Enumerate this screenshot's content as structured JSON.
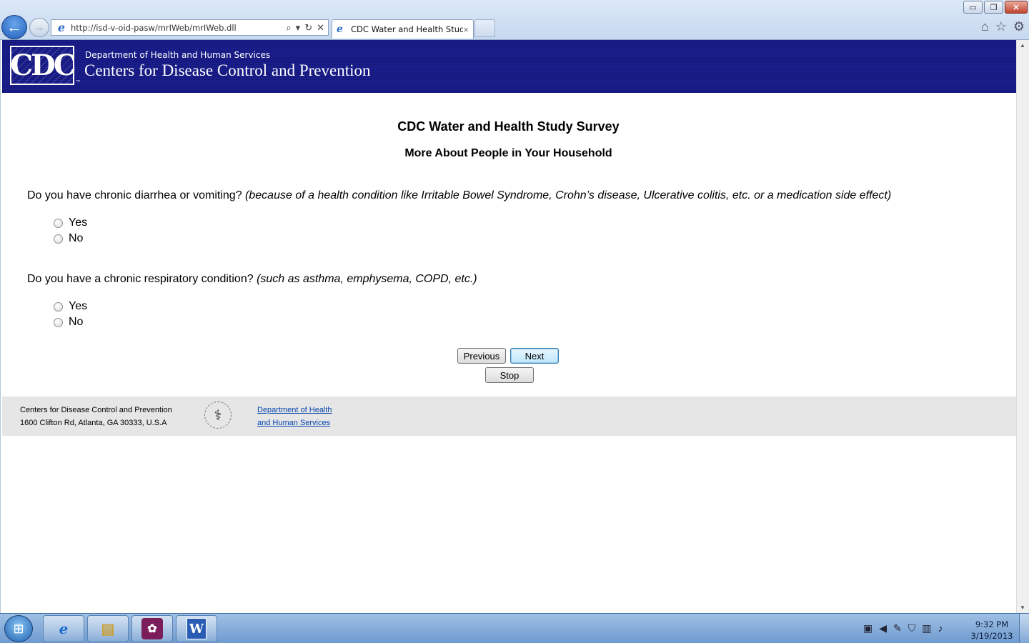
{
  "browser": {
    "url": "http://isd-v-oid-pasw/mrIWeb/mrIWeb.dll",
    "tab_title": "CDC Water and Health Study",
    "tab_close": "×",
    "window_buttons": {
      "minimize": "▭",
      "restore": "❐",
      "close": "✕"
    }
  },
  "header": {
    "logo_text": "CDC",
    "logo_tm": "™",
    "department": "Department of Health and Human Services",
    "agency": "Centers for Disease Control and Prevention"
  },
  "survey": {
    "title": "CDC Water and Health Study Survey",
    "subtitle": "More About People in Your Household",
    "questions": [
      {
        "text": "Do you have chronic diarrhea or vomiting? ",
        "hint": "(because of a health condition like Irritable Bowel Syndrome, Crohn’s disease, Ulcerative colitis, etc. or a medication side effect)",
        "options": [
          "Yes",
          "No"
        ]
      },
      {
        "text": "Do you have a chronic respiratory condition? ",
        "hint": "(such as asthma, emphysema, COPD, etc.)",
        "options": [
          "Yes",
          "No"
        ]
      }
    ],
    "buttons": {
      "previous": "Previous",
      "next": "Next",
      "stop": "Stop"
    }
  },
  "footer": {
    "address_line1": "Centers for Disease Control and Prevention",
    "address_line2": "1600 Clifton Rd, Atlanta, GA 30333, U.S.A",
    "hhs_link_line1": "Department of Health",
    "hhs_link_line2": "and Human Services"
  },
  "taskbar": {
    "word_label": "W",
    "time": "9:32 PM",
    "date": "3/19/2013"
  }
}
